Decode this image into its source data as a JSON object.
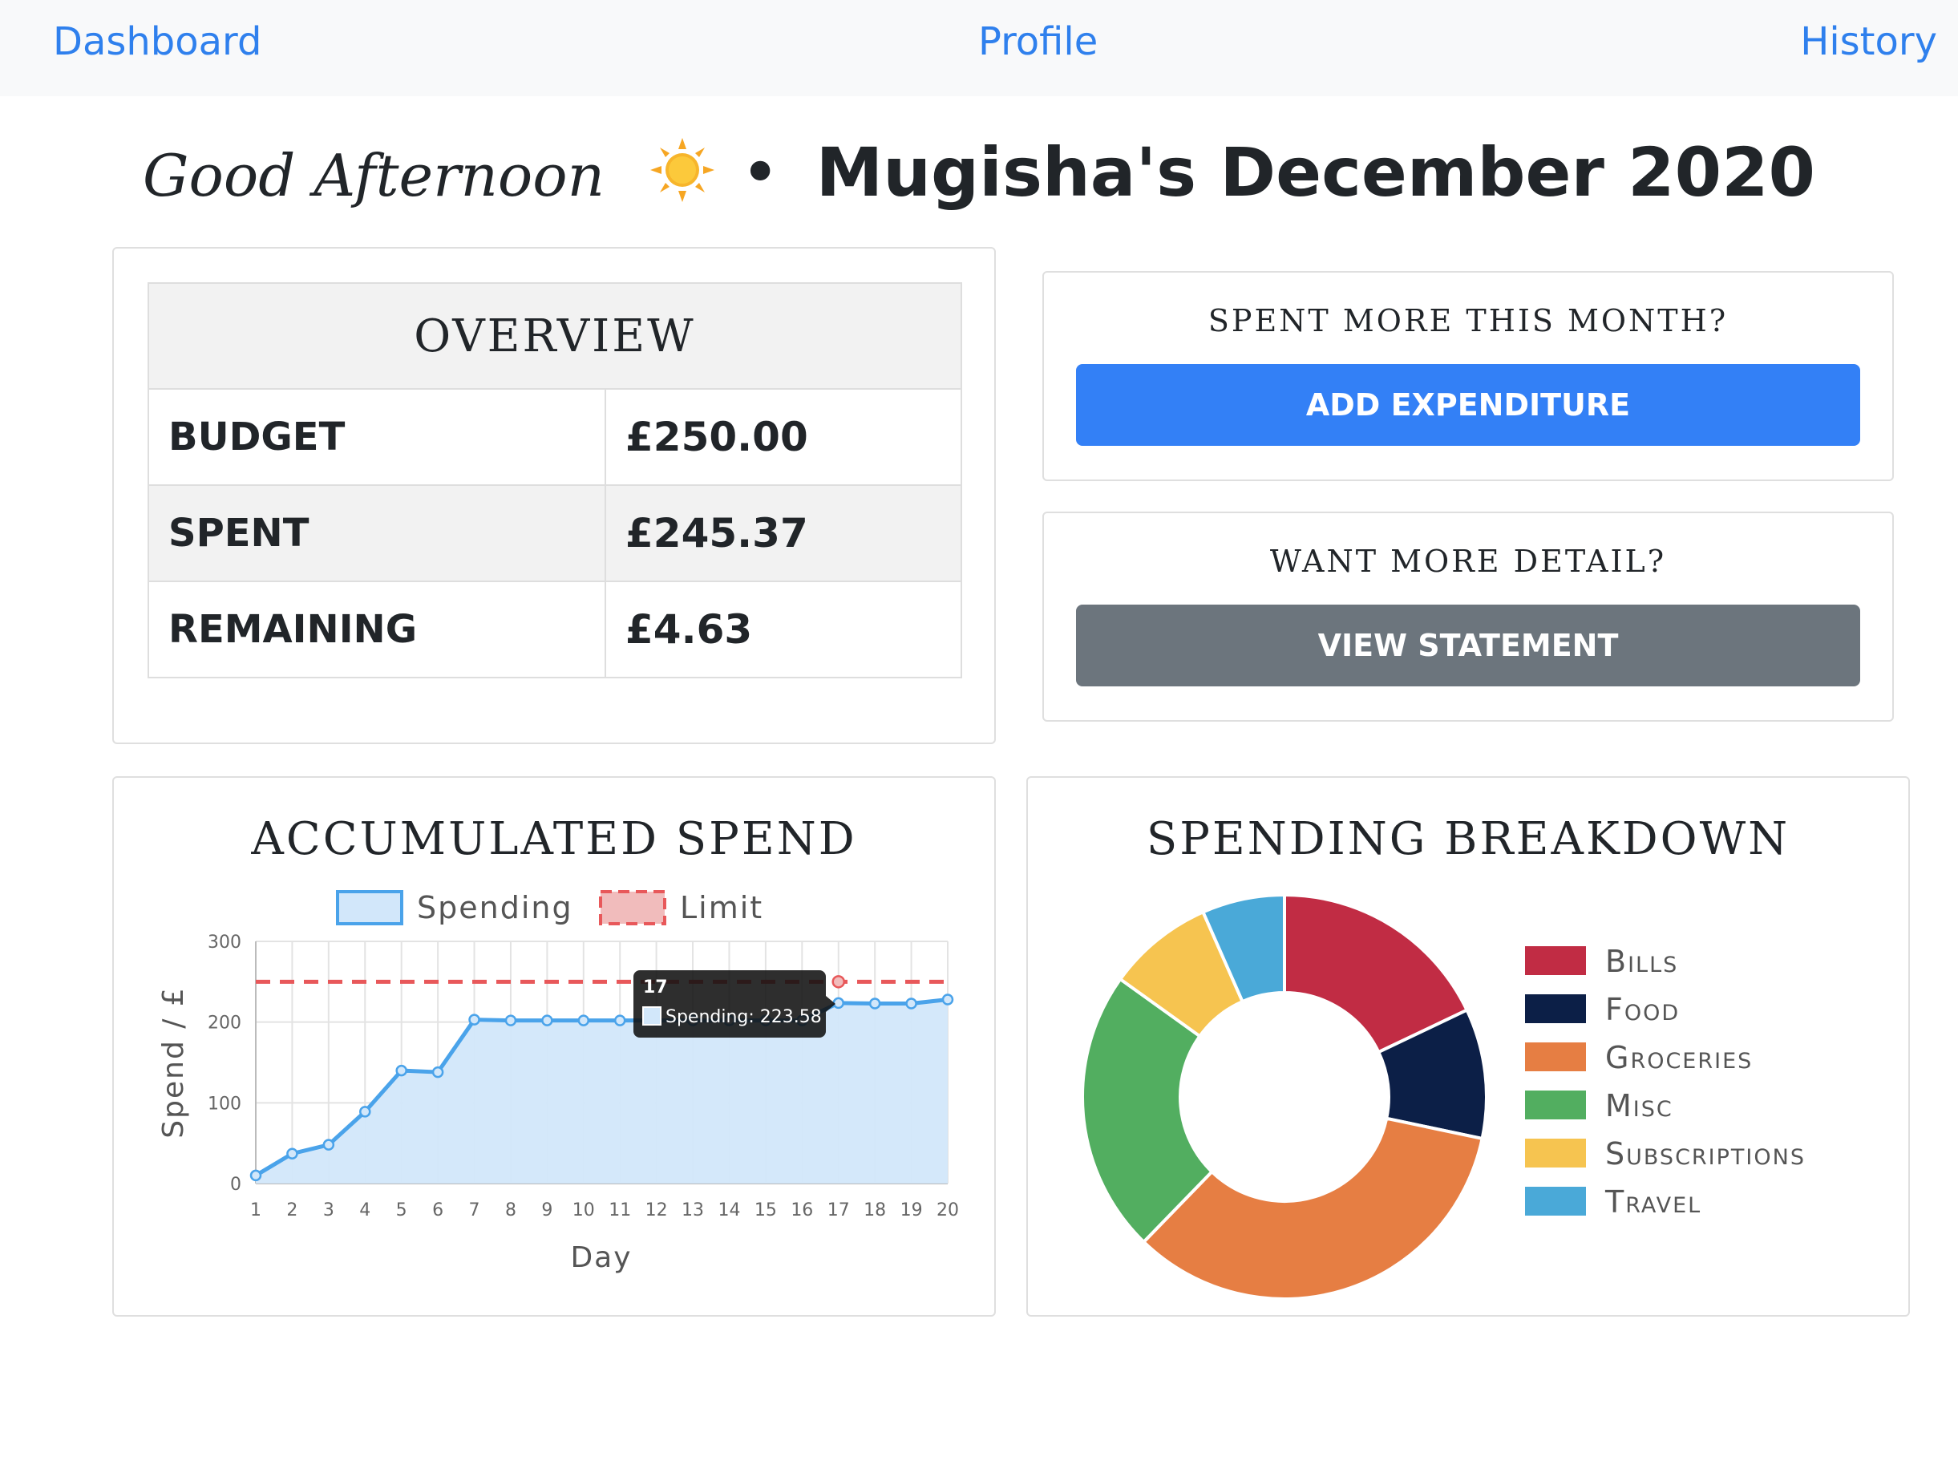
{
  "nav": {
    "dashboard": "Dashboard",
    "profile": "Profile",
    "history": "History"
  },
  "header": {
    "greeting": "Good Afternoon",
    "separator": "•",
    "title": "Mugisha's December 2020"
  },
  "overview": {
    "heading": "OVERVIEW",
    "rows": [
      {
        "label": "BUDGET",
        "value": "£250.00"
      },
      {
        "label": "SPENT",
        "value": "£245.37"
      },
      {
        "label": "REMAINING",
        "value": "£4.63"
      }
    ]
  },
  "add_card": {
    "prompt": "SPENT MORE THIS MONTH?",
    "button": "ADD EXPENDITURE"
  },
  "detail_card": {
    "prompt": "WANT MORE DETAIL?",
    "button": "VIEW STATEMENT"
  },
  "colors": {
    "link": "#2f80ed",
    "primary": "#3380f6",
    "secondary": "#6c757d",
    "spending_line": "#4aa3ea",
    "spending_fill": "#d2e7fa",
    "limit_line": "#e8585a"
  },
  "chart_data": [
    {
      "type": "line",
      "title": "ACCUMULATED SPEND",
      "xlabel": "Day",
      "ylabel": "Spend / £",
      "x": [
        1,
        2,
        3,
        4,
        5,
        6,
        7,
        8,
        9,
        10,
        11,
        12,
        13,
        14,
        15,
        16,
        17,
        18,
        19,
        20
      ],
      "ylim": [
        0,
        300
      ],
      "yticks": [
        0,
        100,
        200,
        300
      ],
      "grid": true,
      "legend": "top",
      "series": [
        {
          "name": "Spending",
          "color": "#4aa3ea",
          "fill": "#d2e7fa",
          "style": "solid",
          "values": [
            10,
            37,
            48,
            89,
            140,
            138,
            203,
            202,
            202,
            202,
            202,
            202,
            202,
            202,
            202,
            202,
            223.58,
            223,
            223,
            228
          ]
        },
        {
          "name": "Limit",
          "color": "#e8585a",
          "style": "dashed",
          "values": [
            250,
            250,
            250,
            250,
            250,
            250,
            250,
            250,
            250,
            250,
            250,
            250,
            250,
            250,
            250,
            250,
            250,
            250,
            250,
            250
          ]
        }
      ],
      "tooltip": {
        "x": 17,
        "title": "17",
        "text": "Spending: 223.58"
      }
    },
    {
      "type": "pie",
      "title": "SPENDING BREAKDOWN",
      "legend": "right",
      "donut": true,
      "categories": [
        "Bills",
        "Food",
        "Groceries",
        "Misc",
        "Subscriptions",
        "Travel"
      ],
      "values": [
        19,
        11,
        36,
        24,
        9,
        7
      ],
      "colors": [
        "#c12c44",
        "#0c1f47",
        "#e67e43",
        "#52ae60",
        "#f6c450",
        "#4aa9d8"
      ]
    }
  ]
}
